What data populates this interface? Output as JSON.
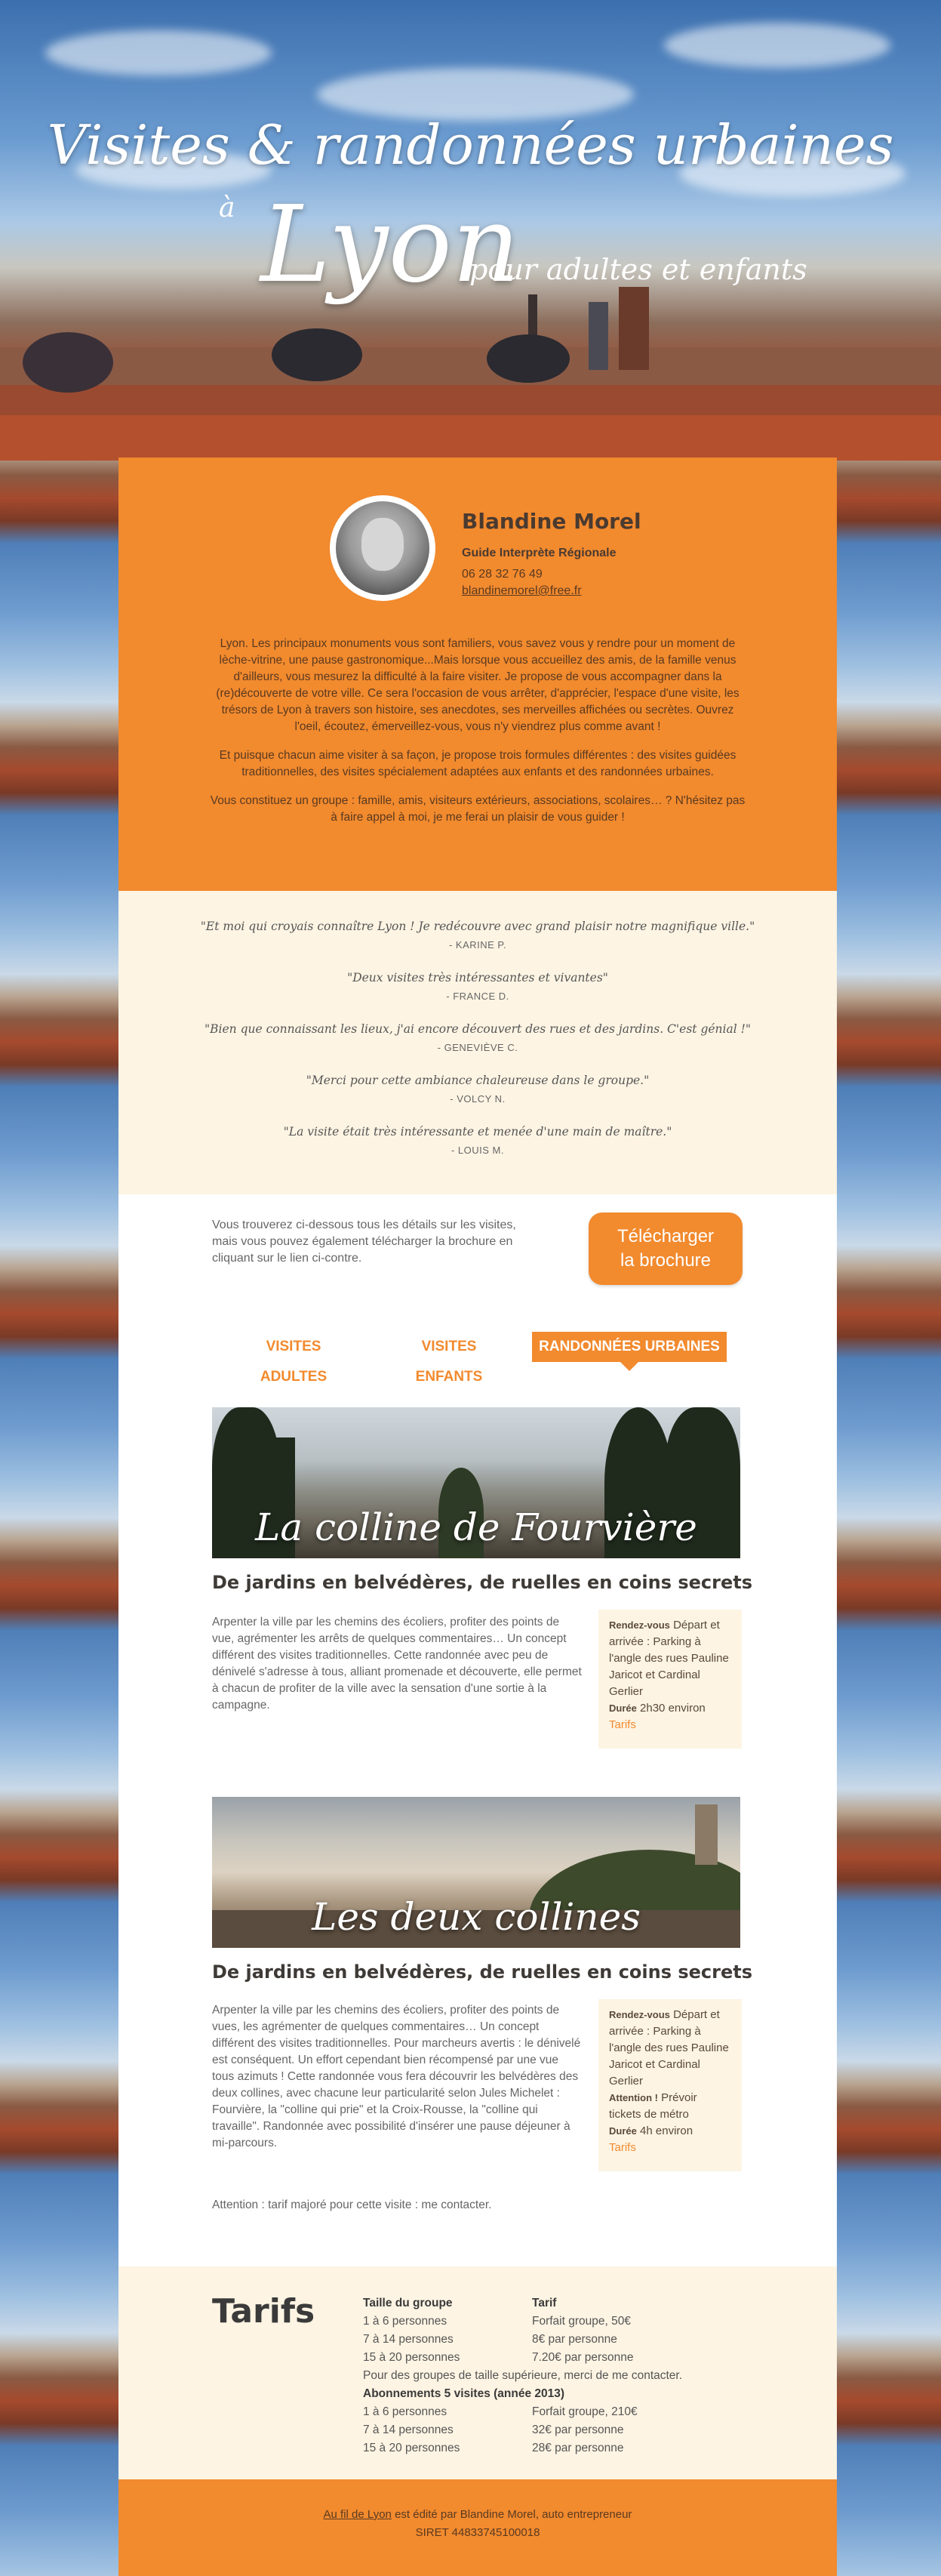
{
  "hero": {
    "title": "Visites & randonnées urbaines",
    "a": "à",
    "city": "Lyon",
    "subtitle": "pour adultes et enfants"
  },
  "profile": {
    "name": "Blandine Morel",
    "role": "Guide Interprète Régionale",
    "phone": "06 28 32 76 49",
    "email": "blandinemorel@free.fr",
    "intro": [
      "Lyon. Les principaux monuments vous sont familiers, vous savez vous y rendre pour un moment de lèche-vitrine, une pause gastronomique...Mais lorsque vous accueillez des amis, de la famille venus d'ailleurs, vous mesurez la difficulté à la faire visiter. Je propose de vous accompagner dans la (re)découverte de votre ville. Ce sera l'occasion de vous arrêter, d'apprécier, l'espace d'une visite, les trésors de Lyon à travers son histoire, ses anecdotes, ses merveilles affichées ou secrètes. Ouvrez l'oeil, écoutez, émerveillez-vous, vous n'y viendrez plus comme avant !",
      "Et puisque chacun aime visiter à sa façon, je propose trois formules différentes : des visites guidées traditionnelles, des visites spécialement adaptées aux enfants et des randonnées urbaines.",
      "Vous constituez un groupe : famille, amis, visiteurs extérieurs, associations, scolaires… ? N'hésitez pas à faire appel à moi, je me ferai un plaisir de vous guider !"
    ]
  },
  "quotes": [
    {
      "text": "\"Et moi qui croyais connaître Lyon ! Je redécouvre avec grand plaisir notre magnifique ville.\"",
      "author": "- KARINE P."
    },
    {
      "text": "\"Deux visites très intéressantes et vivantes\"",
      "author": "- FRANCE D."
    },
    {
      "text": "\"Bien que connaissant les lieux, j'ai encore découvert des rues et des jardins. C'est génial !\"",
      "author": "- GENEVIÈVE C."
    },
    {
      "text": "\"Merci pour cette ambiance chaleureuse dans le groupe.\"",
      "author": "- VOLCY N."
    },
    {
      "text": "\"La visite était très intéressante et menée d'une main de maître.\"",
      "author": "- LOUIS M."
    }
  ],
  "download": {
    "text": "Vous trouverez ci-dessous tous les détails sur les visites, mais vous pouvez également télécharger la brochure en cliquant sur le lien ci-contre.",
    "button_line1": "Télécharger",
    "button_line2": "la brochure"
  },
  "tabs": [
    "VISITES ADULTES",
    "VISITES ENFANTS",
    "RANDONNÉES URBAINES"
  ],
  "tours": [
    {
      "banner_title": "La colline de Fourvière",
      "title": "De jardins en belvédères, de ruelles en coins secrets",
      "body": "Arpenter la ville par les chemins des écoliers, profiter des points de vue, agrémenter les arrêts de quelques commentaires… Un concept différent des visites traditionnelles. Cette randonnée avec peu de dénivelé s'adresse à tous, alliant promenade et découverte, elle permet à chacun de profiter de la ville avec la sensation d'une sortie à la campagne.",
      "rdv_label": "Rendez-vous",
      "rdv_text": "Départ et arrivée : Parking à l'angle des rues Pauline Jaricot et Cardinal Gerlier",
      "duree_label": "Durée",
      "duree_text": "2h30 environ",
      "tarifs_link": "Tarifs"
    },
    {
      "banner_title": "Les deux collines",
      "title": "De jardins en belvédères, de ruelles en coins secrets",
      "body": "Arpenter la ville par les chemins des écoliers, profiter des points de vues, les agrémenter de quelques commentaires… Un concept différent des visites traditionnelles. Pour marcheurs avertis : le dénivelé est conséquent. Un effort cependant bien récompensé par une vue tous azimuts ! Cette randonnée vous fera découvrir les belvédères des deux collines, avec chacune leur particularité selon Jules Michelet : Fourvière, la \"colline qui prie\" et la Croix-Rousse, la \"colline qui travaille\". Randonnée avec possibilité d'insérer une pause déjeuner à mi-parcours.",
      "note": "Attention : tarif majoré pour cette visite : me contacter.",
      "rdv_label": "Rendez-vous",
      "rdv_text": "Départ et arrivée : Parking à l'angle des rues Pauline Jaricot et Cardinal Gerlier",
      "attention_label": "Attention !",
      "attention_text": "Prévoir tickets de métro",
      "duree_label": "Durée",
      "duree_text": "4h environ",
      "tarifs_link": "Tarifs"
    }
  ],
  "tarifs": {
    "title": "Tarifs",
    "col1_header": "Taille du groupe",
    "col2_header": "Tarif",
    "rows": [
      {
        "size": "1 à 6 personnes",
        "price": "Forfait groupe, 50€"
      },
      {
        "size": "7 à 14 personnes",
        "price": "8€ par personne"
      },
      {
        "size": "15 à 20 personnes",
        "price": "7.20€ par personne"
      }
    ],
    "note": "Pour des groupes de taille supérieure, merci de me contacter.",
    "abonnements_title": "Abonnements 5 visites (année 2013)",
    "abo_rows": [
      {
        "size": "1 à 6 personnes",
        "price": "Forfait groupe, 210€"
      },
      {
        "size": "7 à 14 personnes",
        "price": "32€ par personne"
      },
      {
        "size": "15 à 20 personnes",
        "price": "28€ par personne"
      }
    ]
  },
  "footer": {
    "link": "Au fil de Lyon",
    "text": "est édité par Blandine Morel, auto entrepreneur",
    "siret": "SIRET 44833745100018"
  },
  "colors": {
    "accent": "#f28a2e",
    "cream": "#fdf4e3"
  }
}
